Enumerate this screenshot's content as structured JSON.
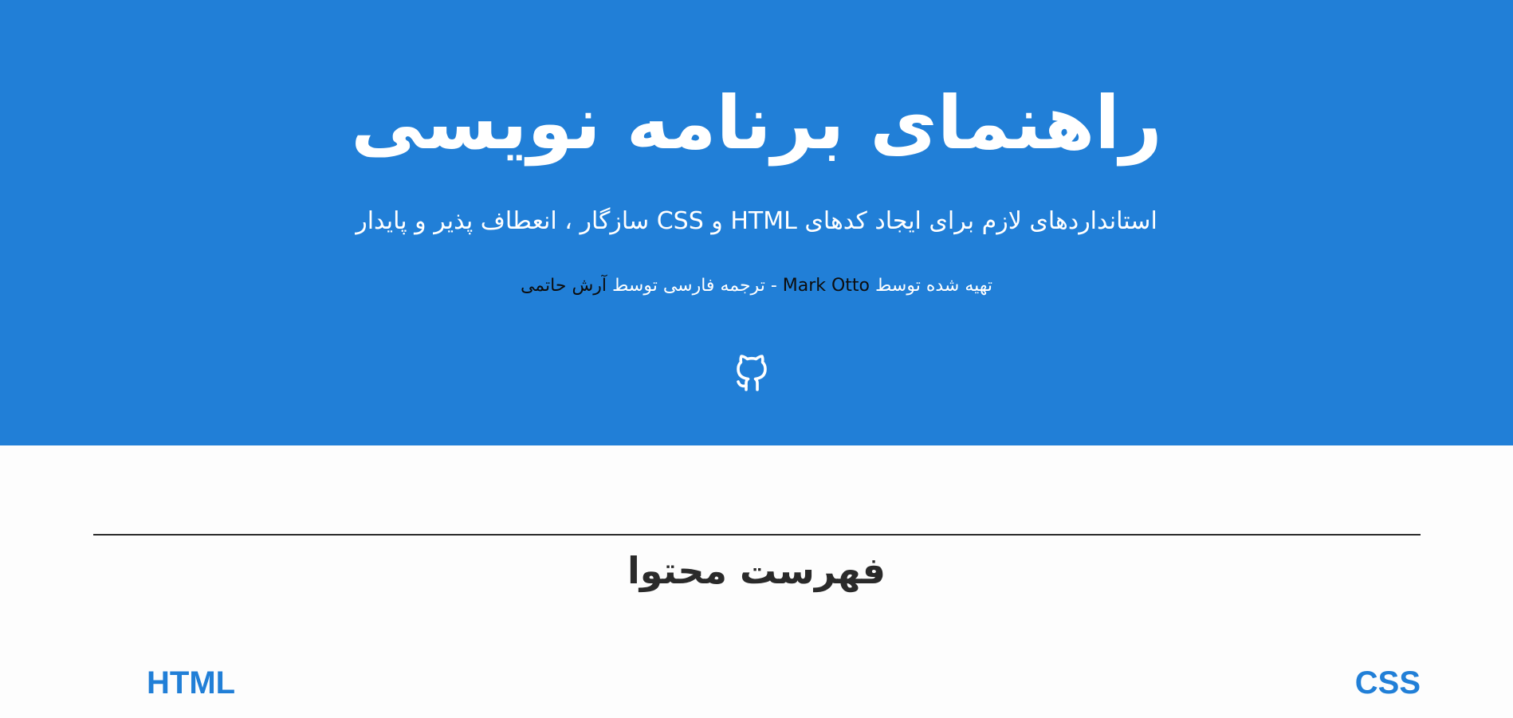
{
  "hero": {
    "background_color": "#217fd7",
    "title": "راهنمای برنامه نویسی",
    "subtitle": "استانداردهای لازم برای ایجاد کدهای HTML و CSS سازگار ، انعطاف پذیر و پایدار",
    "credits": {
      "prefix": "تهیه شده توسط ",
      "author_link": "Mark Otto",
      "middle": " - ترجمه فارسی توسط ",
      "translator_link": "آرش حاتمی"
    },
    "github_icon": "github-icon"
  },
  "toc": {
    "heading": "فهرست محتوا",
    "sections": {
      "css": "CSS",
      "html": "HTML"
    },
    "link_color": "#217fd7"
  }
}
